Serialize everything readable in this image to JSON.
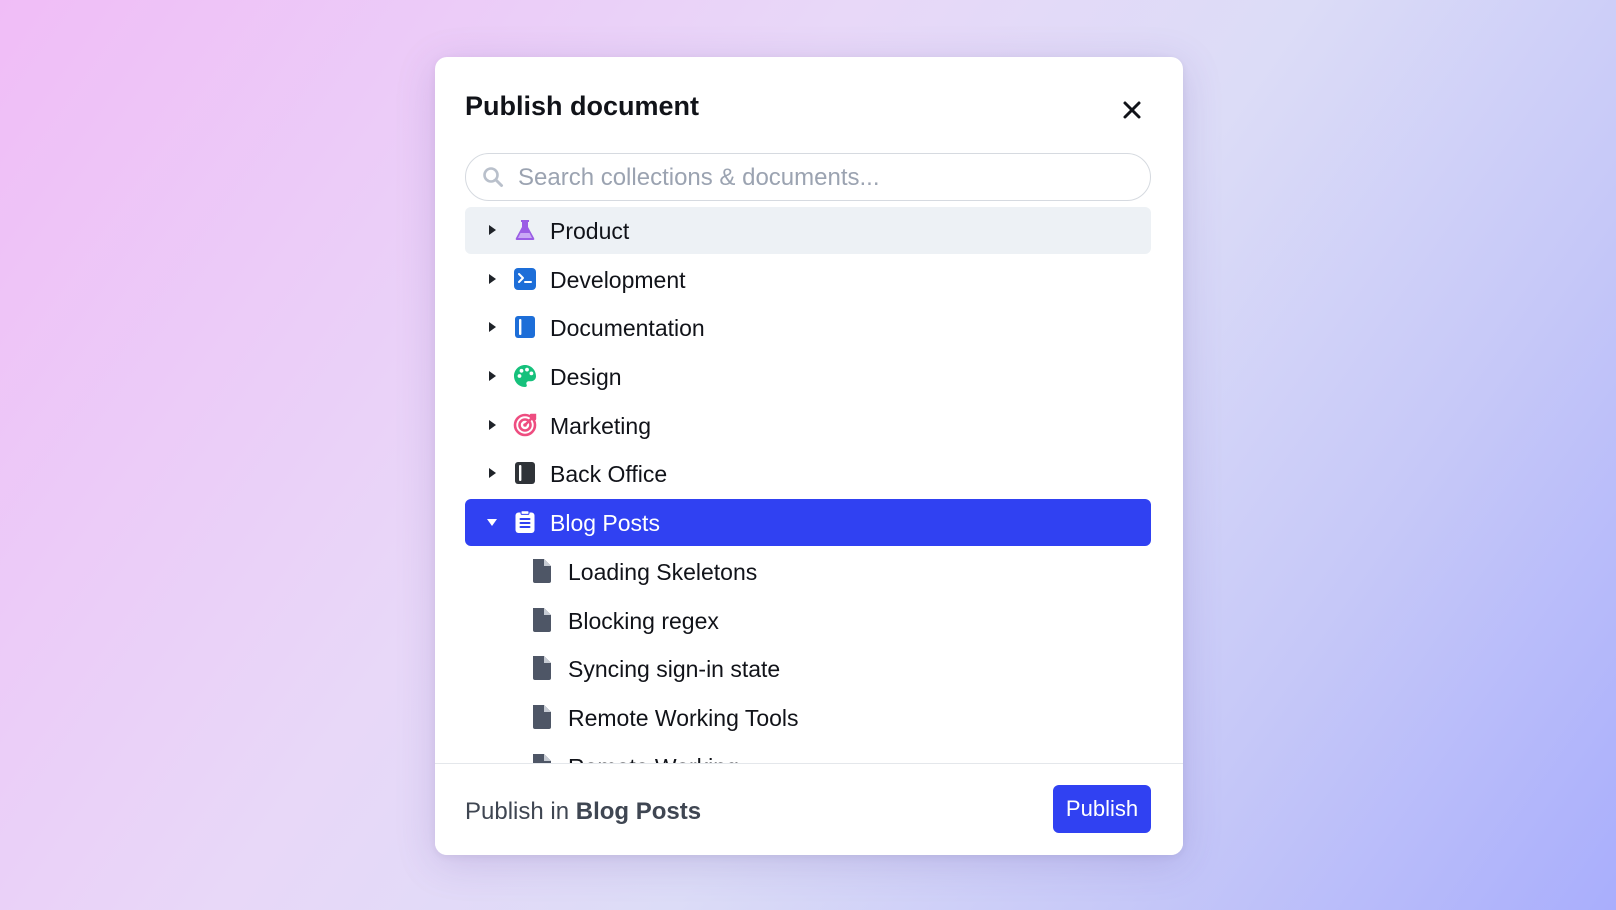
{
  "dialog": {
    "title": "Publish document",
    "search": {
      "placeholder": "Search collections & documents..."
    },
    "collections": [
      {
        "label": "Product",
        "icon": "beaker-icon",
        "color": "#9b5de5"
      },
      {
        "label": "Development",
        "icon": "terminal-icon",
        "color": "#1d6ed8"
      },
      {
        "label": "Documentation",
        "icon": "book-icon",
        "color": "#1d6ed8"
      },
      {
        "label": "Design",
        "icon": "palette-icon",
        "color": "#16c17c"
      },
      {
        "label": "Marketing",
        "icon": "target-icon",
        "color": "#ee4d80"
      },
      {
        "label": "Back Office",
        "icon": "notebook-icon",
        "color": "#2f3338"
      },
      {
        "label": "Blog Posts",
        "icon": "clipboard-icon",
        "color": "#ffffff",
        "expanded": true,
        "selected": true
      }
    ],
    "documents": [
      {
        "label": "Loading Skeletons",
        "icon": "document-icon"
      },
      {
        "label": "Blocking regex",
        "icon": "document-icon"
      },
      {
        "label": "Syncing sign-in state",
        "icon": "document-icon"
      },
      {
        "label": "Remote Working Tools",
        "icon": "document-icon"
      },
      {
        "label": "Remote Working",
        "icon": "document-icon"
      }
    ],
    "footer": {
      "prefix": "Publish in",
      "target": "Blog Posts",
      "publish_label": "Publish"
    }
  },
  "colors": {
    "accent": "#3041f2",
    "hover_row": "#edf1f5",
    "document_icon": "#4e5666"
  }
}
